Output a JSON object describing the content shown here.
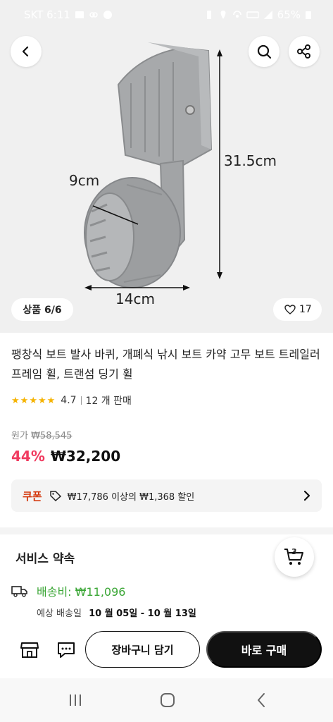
{
  "status_bar": {
    "carrier_time": "SKT 6:11",
    "battery": "65%"
  },
  "gallery": {
    "counter": "상품 6/6",
    "likes": "17",
    "dimensions": {
      "width_label": "9cm",
      "height_label": "31.5cm",
      "length_label": "14cm"
    }
  },
  "product": {
    "title": "팽창식 보트 발사 바퀴, 개폐식 낚시 보트 카약 고무 보트 트레일러 프레임 휠, 트랜섬 딩기 휠",
    "rating_value": 4.7,
    "rating": "4.7",
    "sold": "12 개 판매",
    "original_price_label": "원가",
    "original_price": "₩58,545",
    "discount": "44%",
    "price": "₩32,200"
  },
  "coupon": {
    "label": "쿠폰",
    "text": "₩17,786 이상의 ₩1,368 할인"
  },
  "service": {
    "title": "서비스 약속",
    "cart_count": "3",
    "shipping": "배송비: ₩11,096",
    "delivery_label": "예상 배송일",
    "delivery_dates": "10 월 05일 - 10 월 13일"
  },
  "actions": {
    "add_to_cart": "장바구니 담기",
    "buy_now": "바로 구매"
  },
  "colors": {
    "discount": "#f03a5f",
    "shipping": "#3aa635",
    "coupon": "#d4380d",
    "star": "#f5b301"
  }
}
